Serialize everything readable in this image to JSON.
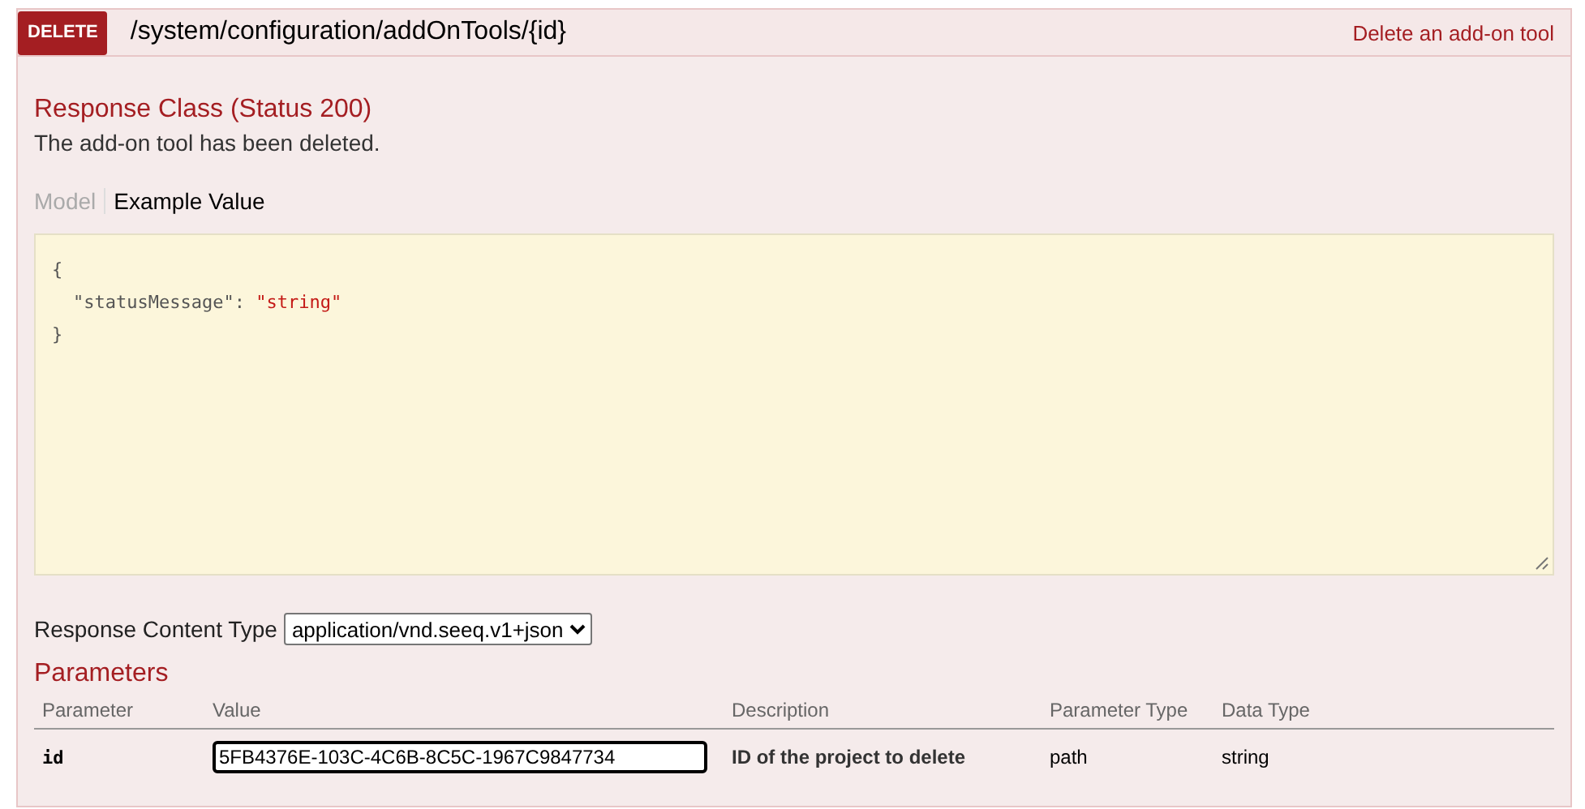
{
  "operation": {
    "method": "DELETE",
    "path": "/system/configuration/addOnTools/{id}",
    "summary": "Delete an add-on tool"
  },
  "response_class": {
    "title": "Response Class (Status 200)",
    "description": "The add-on tool has been deleted."
  },
  "tabs": [
    {
      "label": "Model",
      "selected": false
    },
    {
      "label": "Example Value",
      "selected": true
    }
  ],
  "example": {
    "lines": [
      {
        "indented": false,
        "tokens": [
          {
            "kind": "punct",
            "text": "{"
          }
        ]
      },
      {
        "indented": true,
        "tokens": [
          {
            "kind": "key",
            "text": "\"statusMessage\""
          },
          {
            "kind": "punct",
            "text": ": "
          },
          {
            "kind": "string",
            "text": "\"string\""
          }
        ]
      },
      {
        "indented": false,
        "tokens": [
          {
            "kind": "punct",
            "text": "}"
          }
        ]
      }
    ]
  },
  "response_content_type": {
    "label": "Response Content Type",
    "value": "application/vnd.seeq.v1+json"
  },
  "parameters": {
    "title": "Parameters",
    "columns": [
      "Parameter",
      "Value",
      "Description",
      "Parameter Type",
      "Data Type"
    ],
    "rows": [
      {
        "name": "id",
        "value": "5FB4376E-103C-4C6B-8C5C-1967C9847734",
        "description": "ID of the project to delete",
        "parameter_type": "path",
        "data_type": "string"
      }
    ]
  }
}
